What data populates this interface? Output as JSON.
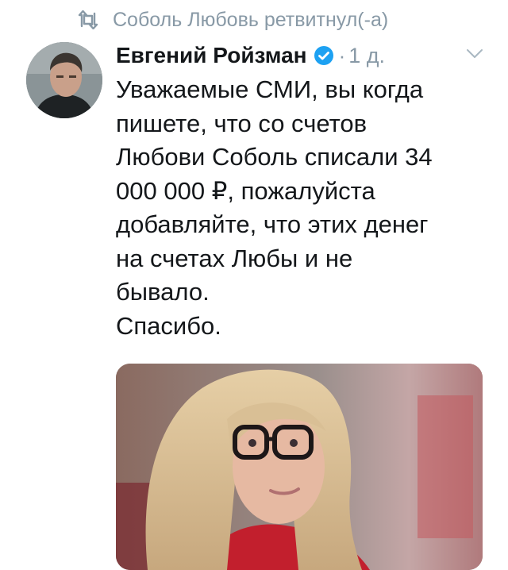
{
  "retweet": {
    "icon": "retweet-icon",
    "text": "Соболь Любовь ретвитнул(-а)"
  },
  "tweet": {
    "author": {
      "name": "Евгений Ройзман",
      "verified": true,
      "avatar_icon": "avatar"
    },
    "separator": "·",
    "time": "1 д.",
    "text": "Уважаемые СМИ, вы когда\nпишете, что со счетов\nЛюбови Соболь списали 34\n000 000 ₽, пожалуйста\nдобавляйте, что этих денег\nна счетах Любы и не\nбывало.\nСпасибо."
  },
  "colors": {
    "secondary_text": "#8899a6",
    "primary_text": "#14171a",
    "verified_blue": "#1da1f2",
    "background": "#ffffff"
  }
}
